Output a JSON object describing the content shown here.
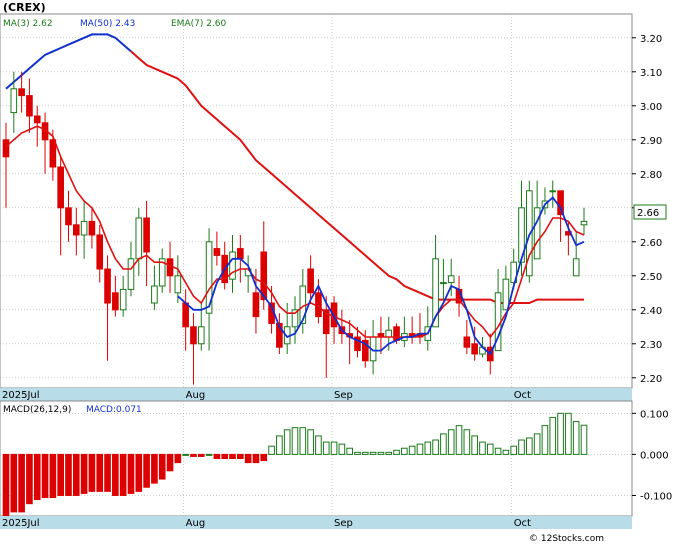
{
  "header": {
    "ticker": "(CREX)",
    "ma3": "MA(3)  2.62",
    "ma50": "MA(50)  2.43",
    "ema7": "EMA(7)  2.60"
  },
  "colors": {
    "up": "#1a7a1a",
    "down": "#dd0000",
    "ma3": "#1030d0",
    "ma50": "#e01010",
    "ema7": "#e01010",
    "axis_band": "#b8dce8",
    "grid": "#b0b0b0",
    "price_tag_border": "#1a7a1a"
  },
  "price_tag": "2.66",
  "macd_header": {
    "params": "MACD(26,12,9)",
    "value": "MACD:0.071"
  },
  "watermark": "© 12Stocks.com",
  "chart_data": [
    {
      "type": "candlestick",
      "title": "(CREX)",
      "x": [
        "2025-07-01",
        "2025-07-02",
        "2025-07-03",
        "2025-07-07",
        "2025-07-08",
        "2025-07-09",
        "2025-07-10",
        "2025-07-11",
        "2025-07-14",
        "2025-07-15",
        "2025-07-16",
        "2025-07-17",
        "2025-07-18",
        "2025-07-21",
        "2025-07-22",
        "2025-07-23",
        "2025-07-24",
        "2025-07-25",
        "2025-07-28",
        "2025-07-29",
        "2025-07-30",
        "2025-07-31",
        "2025-08-01",
        "2025-08-04",
        "2025-08-05",
        "2025-08-06",
        "2025-08-07",
        "2025-08-08",
        "2025-08-11",
        "2025-08-12",
        "2025-08-13",
        "2025-08-14",
        "2025-08-15",
        "2025-08-18",
        "2025-08-19",
        "2025-08-20",
        "2025-08-21",
        "2025-08-22",
        "2025-08-25",
        "2025-08-26",
        "2025-08-27",
        "2025-08-28",
        "2025-08-29",
        "2025-09-02",
        "2025-09-03",
        "2025-09-04",
        "2025-09-05",
        "2025-09-08",
        "2025-09-09",
        "2025-09-10",
        "2025-09-11",
        "2025-09-12",
        "2025-09-15",
        "2025-09-16",
        "2025-09-17",
        "2025-09-18",
        "2025-09-19",
        "2025-09-22",
        "2025-09-23",
        "2025-09-24",
        "2025-09-25",
        "2025-09-26",
        "2025-09-29",
        "2025-09-30",
        "2025-10-01",
        "2025-10-02",
        "2025-10-03",
        "2025-10-06",
        "2025-10-07",
        "2025-10-08",
        "2025-10-09",
        "2025-10-10",
        "2025-10-13",
        "2025-10-14",
        "2025-10-15"
      ],
      "open": [
        2.9,
        2.98,
        3.05,
        3.03,
        2.97,
        2.95,
        2.9,
        2.82,
        2.7,
        2.65,
        2.62,
        2.66,
        2.62,
        2.52,
        2.45,
        2.4,
        2.46,
        2.55,
        2.67,
        2.42,
        2.47,
        2.55,
        2.45,
        2.42,
        2.35,
        2.3,
        2.39,
        2.58,
        2.56,
        2.49,
        2.58,
        2.5,
        2.45,
        2.57,
        2.42,
        2.36,
        2.3,
        2.35,
        2.36,
        2.52,
        2.45,
        2.4,
        2.42,
        2.35,
        2.33,
        2.32,
        2.31,
        2.25,
        2.33,
        2.32,
        2.35,
        2.31,
        2.33,
        2.33,
        2.31,
        2.35,
        2.48,
        2.48,
        2.46,
        2.32,
        2.3,
        2.27,
        2.29,
        2.28,
        2.4,
        2.48,
        2.54,
        2.5,
        2.55,
        2.7,
        2.75,
        2.75,
        2.63,
        2.5,
        2.65
      ],
      "close": [
        2.85,
        3.05,
        3.03,
        2.97,
        2.95,
        2.9,
        2.82,
        2.7,
        2.65,
        2.62,
        2.66,
        2.62,
        2.52,
        2.42,
        2.4,
        2.46,
        2.55,
        2.67,
        2.57,
        2.47,
        2.55,
        2.5,
        2.5,
        2.35,
        2.3,
        2.35,
        2.6,
        2.56,
        2.48,
        2.57,
        2.55,
        2.52,
        2.38,
        2.43,
        2.36,
        2.29,
        2.35,
        2.4,
        2.47,
        2.45,
        2.38,
        2.33,
        2.35,
        2.33,
        2.32,
        2.28,
        2.25,
        2.32,
        2.32,
        2.34,
        2.31,
        2.33,
        2.32,
        2.32,
        2.35,
        2.55,
        2.48,
        2.5,
        2.42,
        2.29,
        2.27,
        2.29,
        2.25,
        2.45,
        2.49,
        2.54,
        2.7,
        2.75,
        2.7,
        2.72,
        2.75,
        2.68,
        2.62,
        2.55,
        2.66
      ],
      "high": [
        2.95,
        3.1,
        3.1,
        3.08,
        3.0,
        2.98,
        2.93,
        2.85,
        2.75,
        2.7,
        2.72,
        2.7,
        2.65,
        2.56,
        2.5,
        2.5,
        2.6,
        2.7,
        2.72,
        2.53,
        2.58,
        2.6,
        2.56,
        2.46,
        2.39,
        2.42,
        2.64,
        2.63,
        2.6,
        2.62,
        2.62,
        2.56,
        2.52,
        2.66,
        2.47,
        2.39,
        2.42,
        2.44,
        2.52,
        2.56,
        2.49,
        2.44,
        2.44,
        2.4,
        2.37,
        2.35,
        2.34,
        2.37,
        2.38,
        2.38,
        2.36,
        2.38,
        2.38,
        2.39,
        2.41,
        2.62,
        2.55,
        2.55,
        2.5,
        2.37,
        2.35,
        2.32,
        2.33,
        2.52,
        2.53,
        2.58,
        2.78,
        2.78,
        2.78,
        2.76,
        2.78,
        2.75,
        2.66,
        2.63,
        2.7
      ],
      "low": [
        2.7,
        2.92,
        2.98,
        2.92,
        2.88,
        2.8,
        2.78,
        2.56,
        2.6,
        2.56,
        2.55,
        2.58,
        2.48,
        2.25,
        2.38,
        2.38,
        2.44,
        2.5,
        2.47,
        2.4,
        2.45,
        2.45,
        2.42,
        2.28,
        2.18,
        2.28,
        2.28,
        2.53,
        2.46,
        2.45,
        2.48,
        2.45,
        2.33,
        2.4,
        2.33,
        2.27,
        2.27,
        2.3,
        2.33,
        2.42,
        2.36,
        2.2,
        2.3,
        2.3,
        2.24,
        2.26,
        2.23,
        2.21,
        2.27,
        2.28,
        2.3,
        2.29,
        2.3,
        2.3,
        2.28,
        2.4,
        2.43,
        2.44,
        2.38,
        2.27,
        2.25,
        2.26,
        2.21,
        2.39,
        2.44,
        2.46,
        2.5,
        2.48,
        2.66,
        2.68,
        2.7,
        2.6,
        2.56,
        2.5,
        2.62
      ],
      "series": [
        {
          "name": "MA(3)",
          "values": [
            3.05,
            3.07,
            3.09,
            3.11,
            3.13,
            3.15,
            3.16,
            3.17,
            3.18,
            3.19,
            3.2,
            3.21,
            3.21,
            3.21,
            3.2,
            3.18,
            3.16,
            3.14,
            3.12,
            3.11,
            3.1,
            3.09,
            3.08,
            3.06,
            3.03,
            3.0,
            2.98,
            2.96,
            2.94,
            2.92,
            2.9,
            2.87,
            2.84,
            2.82,
            2.8,
            2.78,
            2.76,
            2.74,
            2.72,
            2.7,
            2.68,
            2.66,
            2.64,
            2.62,
            2.6,
            2.58,
            2.56,
            2.54,
            2.52,
            2.5,
            2.49,
            2.47,
            2.46,
            2.45,
            2.44,
            2.43,
            2.43,
            2.43,
            2.43,
            2.43,
            2.43,
            2.43,
            2.43,
            2.42,
            2.42,
            2.42,
            2.42,
            2.42,
            2.43,
            2.43,
            2.43,
            2.43,
            2.43,
            2.43,
            2.43
          ]
        },
        {
          "name": "MA(50)",
          "values": [
            null,
            null,
            null,
            null,
            null,
            null,
            null,
            null,
            null,
            null,
            null,
            null,
            null,
            null,
            null,
            null,
            null,
            null,
            null,
            null,
            null,
            null,
            null,
            null,
            null,
            null,
            null,
            null,
            null,
            null,
            null,
            null,
            null,
            null,
            null,
            null,
            null,
            null,
            null,
            null,
            null,
            null,
            null,
            null,
            null,
            null,
            null,
            null,
            null,
            null,
            null,
            null,
            null,
            null,
            null,
            null,
            null,
            null,
            null,
            null,
            null,
            null,
            null,
            null,
            null,
            null,
            null,
            null,
            null,
            null,
            null,
            null,
            null,
            null,
            null
          ]
        },
        {
          "name": "EMA(7)",
          "values": [
            2.88,
            2.9,
            2.92,
            2.93,
            2.94,
            2.93,
            2.91,
            2.85,
            2.8,
            2.75,
            2.72,
            2.7,
            2.66,
            2.6,
            2.55,
            2.52,
            2.52,
            2.55,
            2.56,
            2.54,
            2.54,
            2.53,
            2.52,
            2.48,
            2.44,
            2.42,
            2.46,
            2.49,
            2.49,
            2.51,
            2.52,
            2.52,
            2.49,
            2.48,
            2.45,
            2.41,
            2.39,
            2.39,
            2.41,
            2.42,
            2.41,
            2.39,
            2.38,
            2.37,
            2.36,
            2.34,
            2.32,
            2.32,
            2.32,
            2.32,
            2.32,
            2.32,
            2.32,
            2.32,
            2.33,
            2.38,
            2.41,
            2.43,
            2.43,
            2.4,
            2.37,
            2.35,
            2.32,
            2.35,
            2.39,
            2.42,
            2.49,
            2.56,
            2.6,
            2.63,
            2.67,
            2.67,
            2.66,
            2.63,
            2.62
          ]
        },
        {
          "name": "MA(3) line",
          "values": [
            null,
            null,
            null,
            null,
            null,
            null,
            null,
            null,
            null,
            null,
            null,
            null,
            null,
            null,
            null,
            null,
            null,
            null,
            null,
            null,
            null,
            null,
            2.44,
            2.42,
            2.4,
            2.4,
            2.41,
            2.48,
            2.52,
            2.55,
            2.55,
            2.53,
            2.47,
            2.44,
            2.41,
            2.35,
            2.32,
            2.33,
            2.37,
            2.43,
            2.47,
            2.42,
            2.38,
            2.34,
            2.32,
            2.31,
            2.3,
            2.28,
            2.28,
            2.3,
            2.31,
            2.32,
            2.32,
            2.33,
            2.33,
            2.38,
            2.42,
            2.47,
            2.46,
            2.4,
            2.32,
            2.29,
            2.27,
            2.32,
            2.38,
            2.47,
            2.55,
            2.62,
            2.66,
            2.71,
            2.73,
            2.7,
            2.64,
            2.59,
            2.6
          ]
        }
      ],
      "ylim": [
        2.17,
        3.27
      ],
      "yticks": [
        2.2,
        2.3,
        2.4,
        2.5,
        2.6,
        2.7,
        2.8,
        2.9,
        3.0,
        3.1,
        3.2
      ],
      "month_labels": [
        {
          "label": "2025Jul",
          "index": 0
        },
        {
          "label": "Aug",
          "index": 23
        },
        {
          "label": "Sep",
          "index": 42
        },
        {
          "label": "Oct",
          "index": 65
        }
      ],
      "grid": true
    },
    {
      "type": "bar",
      "title": "MACD(26,12,9)",
      "values": [
        -0.15,
        -0.14,
        -0.14,
        -0.12,
        -0.11,
        -0.105,
        -0.105,
        -0.1,
        -0.1,
        -0.1,
        -0.095,
        -0.09,
        -0.09,
        -0.09,
        -0.1,
        -0.1,
        -0.095,
        -0.09,
        -0.08,
        -0.07,
        -0.06,
        -0.04,
        -0.02,
        0.0,
        -0.005,
        -0.005,
        0.0,
        -0.01,
        -0.01,
        -0.01,
        -0.01,
        -0.02,
        -0.02,
        -0.015,
        0.02,
        0.045,
        0.06,
        0.065,
        0.065,
        0.06,
        0.045,
        0.03,
        0.03,
        0.025,
        0.015,
        0.005,
        0.005,
        0.005,
        0.005,
        0.005,
        0.01,
        0.015,
        0.02,
        0.025,
        0.03,
        0.035,
        0.05,
        0.06,
        0.07,
        0.06,
        0.045,
        0.03,
        0.025,
        0.015,
        0.01,
        0.02,
        0.035,
        0.04,
        0.05,
        0.07,
        0.09,
        0.1,
        0.1,
        0.08,
        0.071
      ],
      "ylim": [
        -0.15,
        0.13
      ],
      "yticks": [
        -0.1,
        0.0,
        0.1
      ],
      "month_labels": [
        {
          "label": "2025Jul",
          "index": 0
        },
        {
          "label": "Aug",
          "index": 23
        },
        {
          "label": "Sep",
          "index": 42
        },
        {
          "label": "Oct",
          "index": 65
        }
      ],
      "tick_labels": [
        "0.100",
        "0.000",
        "-0.100"
      ],
      "price_tick_labels": [
        "3.20",
        "3.10",
        "3.00",
        "2.90",
        "2.80",
        "2.70",
        "2.60",
        "2.50",
        "2.40",
        "2.30",
        "2.20"
      ]
    }
  ]
}
